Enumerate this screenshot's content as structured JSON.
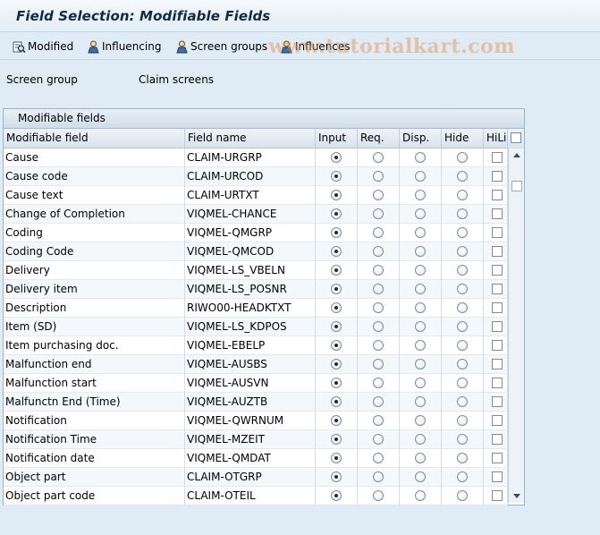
{
  "window": {
    "title": "Field Selection: Modifiable Fields"
  },
  "toolbar": {
    "modified_label": "Modified",
    "influencing_label": "Influencing",
    "screen_groups_label": "Screen groups",
    "influences_label": "Influences"
  },
  "watermark": "www.tutorialkart.com",
  "screen_group": {
    "label": "Screen group",
    "value": "Claim screens"
  },
  "panel": {
    "title": "Modifiable fields",
    "columns": [
      "Modifiable field",
      "Field name",
      "Input",
      "Req.",
      "Disp.",
      "Hide",
      "HiLi"
    ],
    "rows": [
      {
        "field": "Cause",
        "name": "CLAIM-URGRP",
        "selected": "input",
        "hili": false
      },
      {
        "field": "Cause code",
        "name": "CLAIM-URCOD",
        "selected": "input",
        "hili": false
      },
      {
        "field": "Cause text",
        "name": "CLAIM-URTXT",
        "selected": "input",
        "hili": false
      },
      {
        "field": "Change of Completion",
        "name": "VIQMEL-CHANCE",
        "selected": "input",
        "hili": false
      },
      {
        "field": "Coding",
        "name": "VIQMEL-QMGRP",
        "selected": "input",
        "hili": false
      },
      {
        "field": "Coding Code",
        "name": "VIQMEL-QMCOD",
        "selected": "input",
        "hili": false
      },
      {
        "field": "Delivery",
        "name": "VIQMEL-LS_VBELN",
        "selected": "input",
        "hili": false
      },
      {
        "field": "Delivery item",
        "name": "VIQMEL-LS_POSNR",
        "selected": "input",
        "hili": false
      },
      {
        "field": "Description",
        "name": "RIWO00-HEADKTXT",
        "selected": "input",
        "hili": false
      },
      {
        "field": "Item (SD)",
        "name": "VIQMEL-LS_KDPOS",
        "selected": "input",
        "hili": false
      },
      {
        "field": "Item purchasing doc.",
        "name": "VIQMEL-EBELP",
        "selected": "input",
        "hili": false
      },
      {
        "field": "Malfunction end",
        "name": "VIQMEL-AUSBS",
        "selected": "input",
        "hili": false
      },
      {
        "field": "Malfunction start",
        "name": "VIQMEL-AUSVN",
        "selected": "input",
        "hili": false
      },
      {
        "field": "Malfunctn End (Time)",
        "name": "VIQMEL-AUZTB",
        "selected": "input",
        "hili": false
      },
      {
        "field": "Notification",
        "name": "VIQMEL-QWRNUM",
        "selected": "input",
        "hili": false
      },
      {
        "field": "Notification Time",
        "name": "VIQMEL-MZEIT",
        "selected": "input",
        "hili": false
      },
      {
        "field": "Notification date",
        "name": "VIQMEL-QMDAT",
        "selected": "input",
        "hili": false
      },
      {
        "field": "Object part",
        "name": "CLAIM-OTGRP",
        "selected": "input",
        "hili": false
      },
      {
        "field": "Object part code",
        "name": "CLAIM-OTEIL",
        "selected": "input",
        "hili": false
      }
    ]
  },
  "icons": {
    "modified": "magnifier-list-icon",
    "influencing": "person-icon",
    "screen_groups": "person-icon",
    "influences": "person-icon"
  }
}
